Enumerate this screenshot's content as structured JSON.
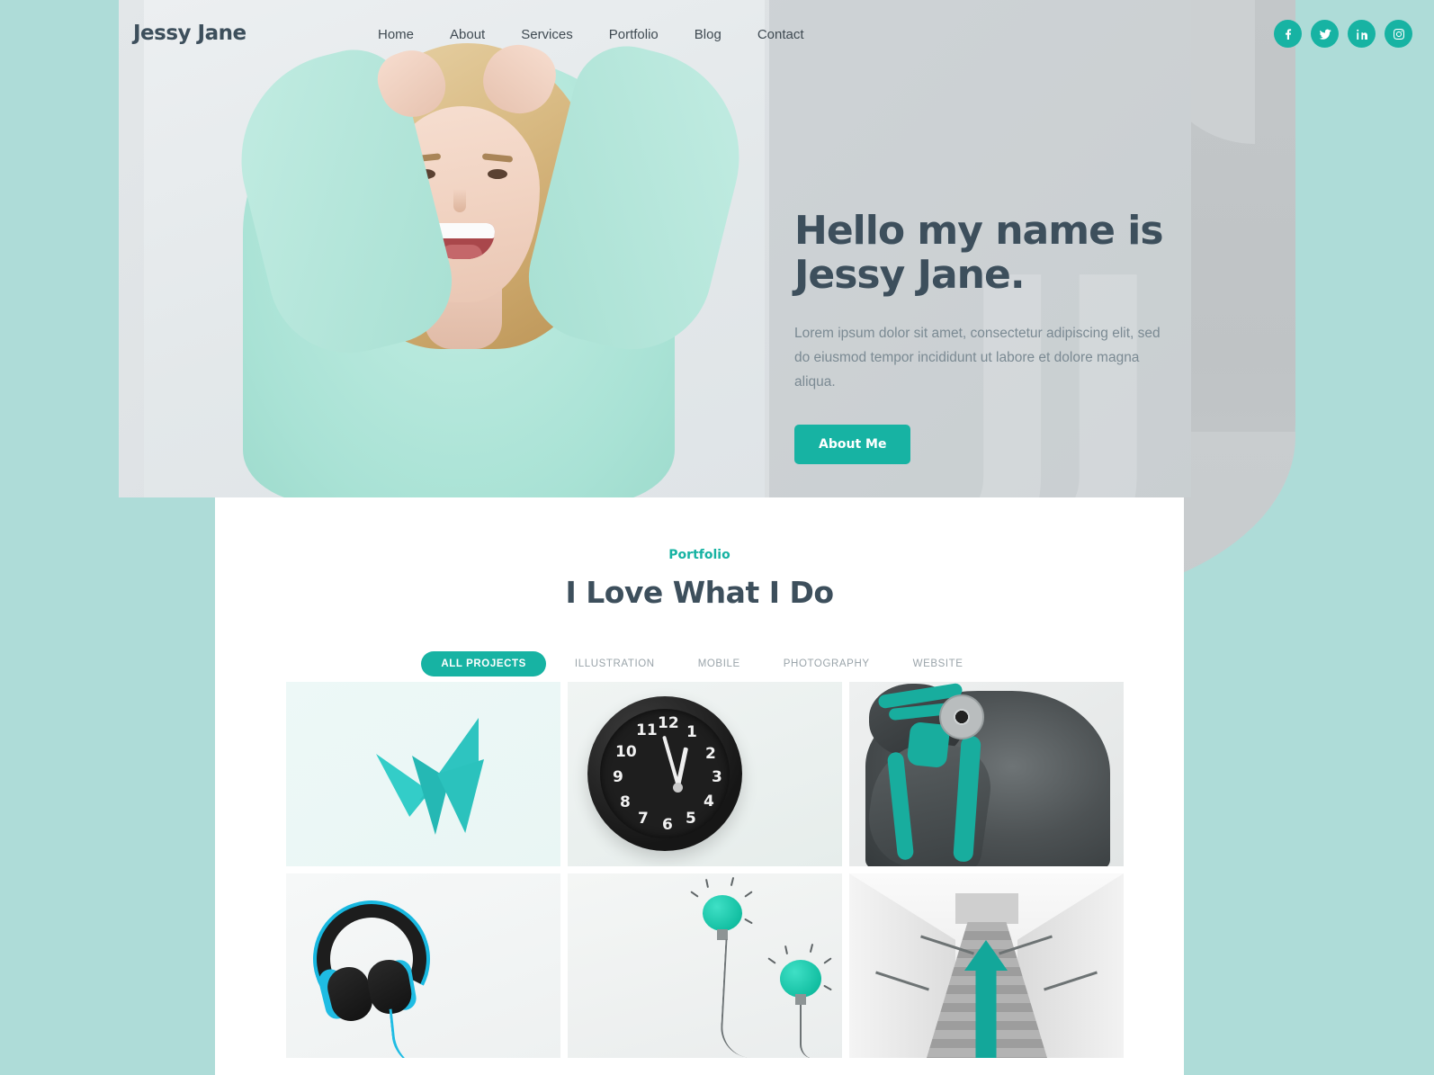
{
  "colors": {
    "accent": "#17b3a3",
    "heading": "#3d4f5c",
    "body_text": "#7b8a93",
    "page_bg": "#aedcd8",
    "hero_bg": "#dde1e4",
    "panel_bg": "#ffffff"
  },
  "header": {
    "brand": "Jessy Jane",
    "nav": [
      {
        "label": "Home",
        "name": "nav-home"
      },
      {
        "label": "About",
        "name": "nav-about"
      },
      {
        "label": "Services",
        "name": "nav-services"
      },
      {
        "label": "Portfolio",
        "name": "nav-portfolio"
      },
      {
        "label": "Blog",
        "name": "nav-blog"
      },
      {
        "label": "Contact",
        "name": "nav-contact"
      }
    ],
    "socials": [
      {
        "icon": "facebook-icon",
        "label": "Facebook"
      },
      {
        "icon": "twitter-icon",
        "label": "Twitter"
      },
      {
        "icon": "linkedin-icon",
        "label": "LinkedIn"
      },
      {
        "icon": "instagram-icon",
        "label": "Instagram"
      }
    ]
  },
  "hero": {
    "heading_line1": "Hello my name is",
    "heading_line2": "Jessy Jane.",
    "paragraph": "Lorem ipsum dolor sit amet, consectetur adipiscing elit, sed do eiusmod tempor incididunt ut labore et dolore magna aliqua.",
    "cta_label": "About Me",
    "portrait_alt": "Smiling blonde woman in mint sweater holding her hair up"
  },
  "portfolio": {
    "eyebrow": "Portfolio",
    "title": "I Love What I Do",
    "filters": [
      {
        "label": "ALL PROJECTS",
        "active": true
      },
      {
        "label": "ILLUSTRATION",
        "active": false
      },
      {
        "label": "MOBILE",
        "active": false
      },
      {
        "label": "PHOTOGRAPHY",
        "active": false
      },
      {
        "label": "WEBSITE",
        "active": false
      }
    ],
    "items": [
      {
        "name": "portfolio-item-origami-butterfly",
        "alt": "Teal origami paper butterfly on pale mint background"
      },
      {
        "name": "portfolio-item-alarm-clock",
        "alt": "Black alarm clock with white numerals"
      },
      {
        "name": "portfolio-item-body-paint",
        "alt": "Body-paint portrait with teal paint strokes"
      },
      {
        "name": "portfolio-item-headphones",
        "alt": "Cyan and black headphones with cable"
      },
      {
        "name": "portfolio-item-paper-bulbs",
        "alt": "Crumpled teal paper balls drawn as light bulbs"
      },
      {
        "name": "portfolio-item-stairs-arrow",
        "alt": "Staircase with teal arrow pointing upward"
      }
    ]
  },
  "clock": {
    "numerals": [
      "12",
      "1",
      "2",
      "3",
      "4",
      "5",
      "6",
      "7",
      "8",
      "9",
      "10",
      "11"
    ]
  }
}
